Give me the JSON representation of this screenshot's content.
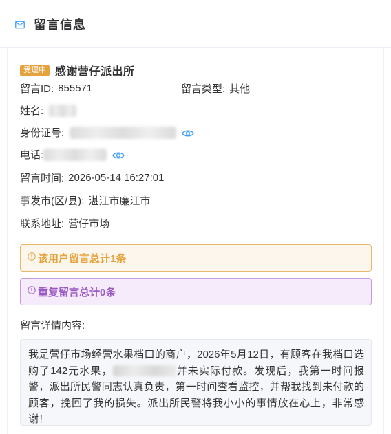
{
  "header": {
    "title": "留言信息",
    "icon": "mail-icon"
  },
  "message": {
    "status_tag": "受理中",
    "subject": "感谢营仔派出所",
    "id_label": "留言ID:",
    "id_value": "855571",
    "type_label": "留言类型:",
    "type_value": "其他",
    "name_label": "姓名:",
    "idcard_label": "身份证号:",
    "phone_label": "电话:",
    "time_label": "留言时间:",
    "time_value": "2026-05-14 16:27:01",
    "city_label": "事发市(区/县):",
    "city_value": "湛江市廉江市",
    "address_label": "联系地址:",
    "address_value": "营仔市场"
  },
  "notices": {
    "user_total": "该用户留言总计1条",
    "duplicate_total": "重复留言总计0条"
  },
  "detail": {
    "label": "留言详情内容:",
    "text_before": "我是营仔市场经营水果档口的商户，2026年5月12日，有顾客在我档口选购了142元水果，",
    "text_after": "并未实际付款。发现后，我第一时间报警，派出所民警同志认真负责，第一时间查看监控，并帮我找到未付款的顾客，挽回了我的损失。派出所民警将我小小的事情放在心上，非常感谢！"
  },
  "colors": {
    "tag_orange": "#e6a23c",
    "notice_orange_text": "#e6a23c",
    "notice_purple_text": "#9b59c4",
    "eye_blue": "#409eff"
  }
}
